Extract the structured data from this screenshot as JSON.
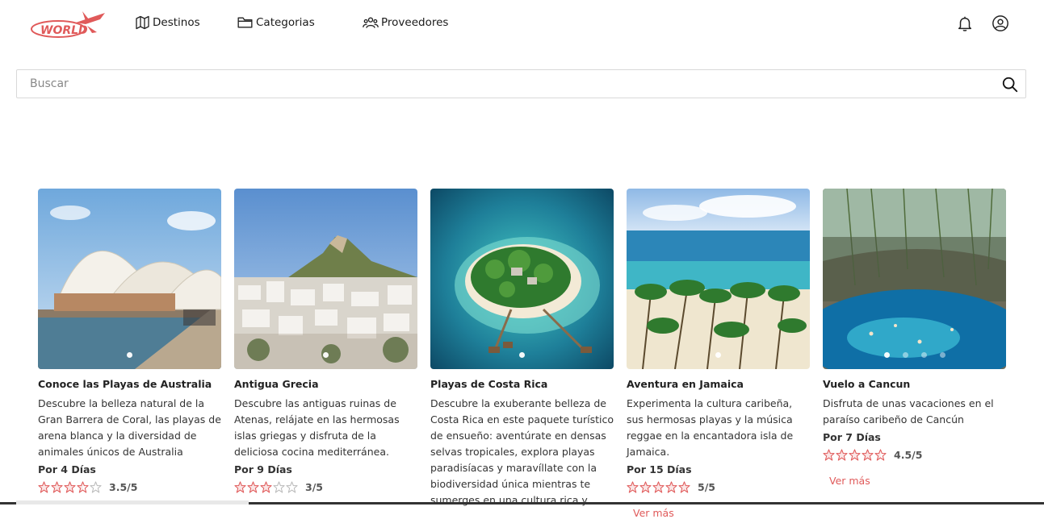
{
  "header": {
    "logo_text": "WORLD",
    "nav": [
      {
        "label": "Destinos",
        "icon": "map-icon"
      },
      {
        "label": "Categorias",
        "icon": "folder-icon"
      },
      {
        "label": "Proveedores",
        "icon": "users-icon"
      }
    ],
    "notifications_icon": "bell-icon",
    "account_icon": "user-circle-icon"
  },
  "search": {
    "placeholder": "Buscar",
    "value": "",
    "icon": "search-icon"
  },
  "colors": {
    "accent": "#e05a5a",
    "star": "#e05a5a"
  },
  "cards": [
    {
      "title": "Conoce las Playas de Australia",
      "description": "Descubre la belleza natural de la Gran Barrera de Coral, las playas de arena blanca y la diversidad de animales únicos de Australia",
      "days": "Por 4 Días",
      "rating_text": "3.5/5",
      "rating": 3.5,
      "image": "sydney-opera-house-photo",
      "show_ver_mas": false
    },
    {
      "title": "Antigua Grecia",
      "description": "Descubre las antiguas ruinas de Atenas, relájate en las hermosas islas griegas y disfruta de la deliciosa cocina mediterránea.",
      "days": "Por 9 Días",
      "rating_text": "3/5",
      "rating": 3,
      "image": "athens-hill-photo",
      "show_ver_mas": false
    },
    {
      "title": "Playas de Costa Rica",
      "description": "Descubre la exuberante belleza de Costa Rica en este paquete turístico de ensueño: aventúrate en densas selvas tropicales, explora playas paradisíacas y maravíllate con la biodiversidad única mientras te sumerges en una cultura rica y",
      "days": "",
      "rating_text": "",
      "rating": 0,
      "image": "tropical-island-photo",
      "show_ver_mas": false
    },
    {
      "title": "Aventura en Jamaica",
      "description": "Experimenta la cultura caribeña, sus hermosas playas y la música reggae en la encantadora isla de Jamaica.",
      "days": "Por 15 Días",
      "rating_text": "5/5",
      "rating": 5,
      "image": "jamaica-beach-photo",
      "show_ver_mas": true,
      "ver_mas": "Ver más"
    },
    {
      "title": "Vuelo a Cancun",
      "description": "Disfruta de unas vacaciones en el paraíso caribeño de Cancún",
      "days": "Por 7 Días",
      "rating_text": "4.5/5",
      "rating": 4.5,
      "image": "cenote-photo",
      "show_ver_mas": true,
      "ver_mas": "Ver más"
    }
  ]
}
